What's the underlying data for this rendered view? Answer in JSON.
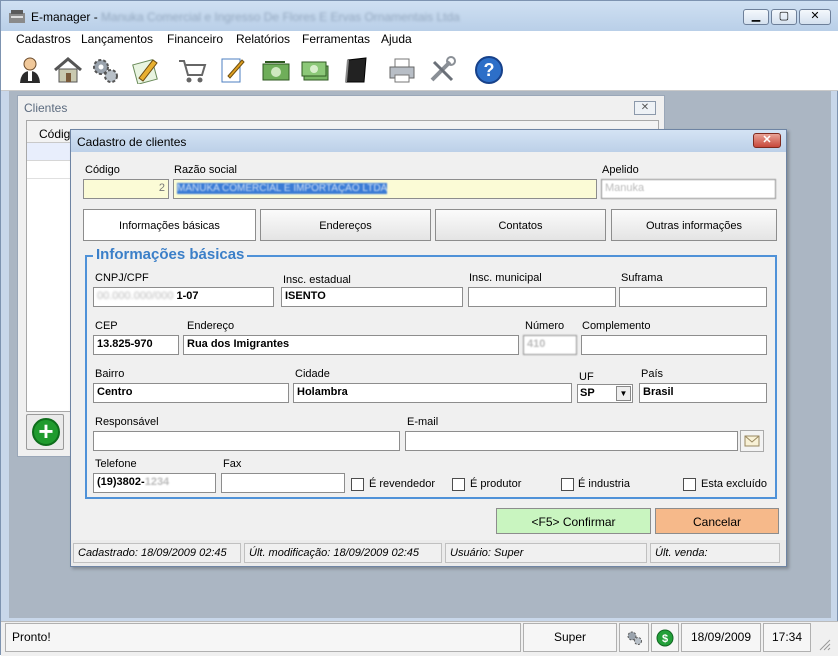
{
  "app": {
    "title": "E-manager - ",
    "title_blurred": "Manuka Comercial e Ingresso De Flores E Ervas Ornamentais Ltda",
    "menus": [
      "Cadastros",
      "Lançamentos",
      "Financeiro",
      "Relatórios",
      "Ferramentas",
      "Ajuda"
    ],
    "toolbar_icons": [
      "user-icon",
      "house-icon",
      "gears-icon",
      "pencil-icon",
      "cart-icon",
      "notepad-icon",
      "money-icon",
      "money-stack-icon",
      "book-icon",
      "printer-icon",
      "tools-icon",
      "help-icon"
    ]
  },
  "clientes": {
    "title": "Clientes",
    "column_codigo": "Código",
    "close": "✕",
    "add": "+"
  },
  "dialog": {
    "title": "Cadastro de clientes",
    "close": "✕",
    "codigo_label": "Código",
    "codigo_value": "2",
    "razao_label": "Razão social",
    "razao_value": "MANUKA COMERCIAL E IMPORTAÇÃO LTDA",
    "apelido_label": "Apelido",
    "apelido_value": "Manuka",
    "tabs": [
      "Informações básicas",
      "Endereços",
      "Contatos",
      "Outras informações"
    ],
    "group_title": "Informações básicas",
    "cnpj_label": "CNPJ/CPF",
    "cnpj_value_visible": "1-07",
    "cnpj_value_blurred": "00.000.000/000",
    "insc_est_label": "Insc. estadual",
    "insc_est_value": "ISENTO",
    "insc_mun_label": "Insc. municipal",
    "insc_mun_value": "",
    "suframa_label": "Suframa",
    "suframa_value": "",
    "cep_label": "CEP",
    "cep_value": "13.825-970",
    "endereco_label": "Endereço",
    "endereco_value": "Rua dos Imigrantes",
    "numero_label": "Número",
    "numero_value": "410",
    "complemento_label": "Complemento",
    "complemento_value": "",
    "bairro_label": "Bairro",
    "bairro_value": "Centro",
    "cidade_label": "Cidade",
    "cidade_value": "Holambra",
    "uf_label": "UF",
    "uf_value": "SP",
    "pais_label": "País",
    "pais_value": "Brasil",
    "responsavel_label": "Responsável",
    "responsavel_value": "",
    "email_label": "E-mail",
    "email_value": "",
    "telefone_label": "Telefone",
    "telefone_value": "(19)3802-",
    "telefone_blurred": "1234",
    "fax_label": "Fax",
    "fax_value": "",
    "chk_revendedor": "É revendedor",
    "chk_produtor": "É produtor",
    "chk_industria": "É industria",
    "chk_excluido": "Esta excluído",
    "confirm_label": "<F5> Confirmar",
    "cancel_label": "Cancelar",
    "status": {
      "cadastrado": "Cadastrado: 18/09/2009 02:45",
      "modificacao": "Últ. modificação: 18/09/2009 02:45",
      "usuario": "Usuário: Super",
      "venda": "Últ. venda:"
    },
    "colors": {
      "confirm_bg": "#c9f5c0",
      "cancel_bg": "#f6b98a",
      "group_border": "#4f92d8",
      "codigo_bg": "#fbfbd6"
    }
  },
  "statusbar": {
    "message": "Pronto!",
    "user": "Super",
    "date": "18/09/2009",
    "time": "17:34"
  }
}
